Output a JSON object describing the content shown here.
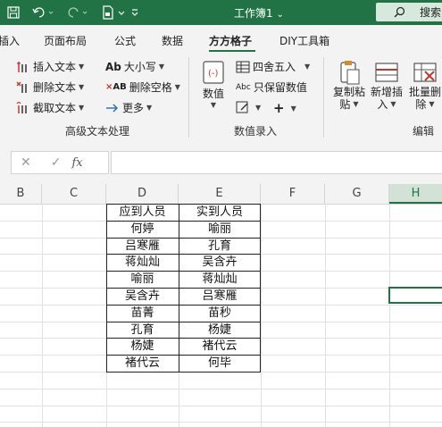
{
  "titlebar": {
    "title": "工作簿1 ",
    "title_arrow": "⌄",
    "search": "搜索"
  },
  "tabs": [
    {
      "label": "插入"
    },
    {
      "label": "页面布局"
    },
    {
      "label": "公式"
    },
    {
      "label": "数据"
    },
    {
      "label": "方方格子"
    },
    {
      "label": "DIY工具箱"
    }
  ],
  "ribbon": {
    "group1": {
      "insert_text": "插入文本",
      "delete_text": "删除文本",
      "extract_text": "截取文本",
      "case": "大小写",
      "delete_spaces": "删除空格",
      "more": "更多",
      "label": "高级文本处理"
    },
    "group2": {
      "numeric": "数值",
      "round": "四舍五入",
      "keep_numeric": "只保留数值",
      "label": "数值录入"
    },
    "group3": {
      "copy_paste_1": "复制粘",
      "copy_paste_2": "贴",
      "new_insert_1": "新增插",
      "new_insert_2": "入",
      "batch_delete_1": "批量删",
      "batch_delete_2": "除",
      "label": "编辑"
    }
  },
  "formula": {
    "fx": "fx"
  },
  "columns": [
    "B",
    "C",
    "D",
    "E",
    "F",
    "G",
    "H"
  ],
  "table": {
    "headers": [
      "应到人员",
      "实到人员"
    ],
    "rows": [
      [
        "何婷",
        "喻丽"
      ],
      [
        "吕寒雁",
        "孔育"
      ],
      [
        "蒋灿灿",
        "吴含卉"
      ],
      [
        "喻丽",
        "蒋灿灿"
      ],
      [
        "吴含卉",
        "吕寒雁"
      ],
      [
        "苗菁",
        "苗秒"
      ],
      [
        "孔育",
        "杨婕"
      ],
      [
        "杨婕",
        "褚代云"
      ],
      [
        "褚代云",
        "何毕"
      ]
    ]
  },
  "colors": {
    "accent": "#217346",
    "ribbon_bg": "#f3f3f3"
  }
}
